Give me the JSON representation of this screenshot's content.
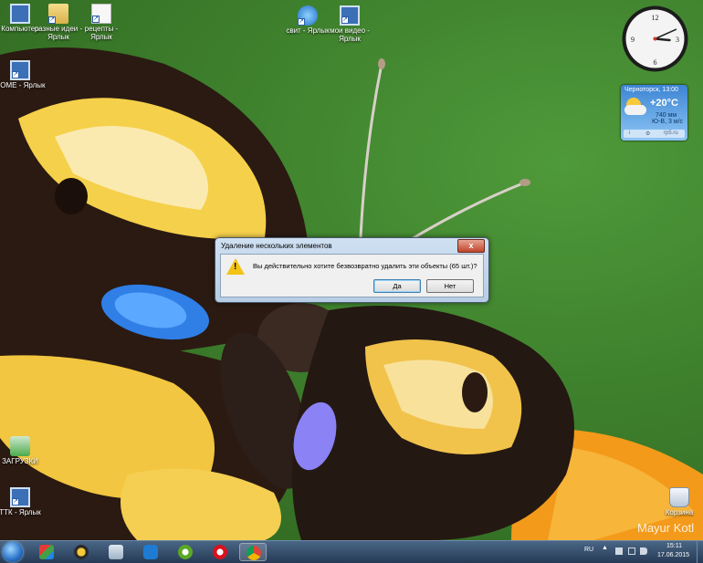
{
  "desktop_icons": [
    {
      "label": "Компьютер",
      "icon": "computer-icon"
    },
    {
      "label": "разные идеи - Ярлык",
      "icon": "folder-shortcut-icon"
    },
    {
      "label": "рецепты - Ярлык",
      "icon": "document-shortcut-icon"
    },
    {
      "label": "свит - Ярлык",
      "icon": "globe-shortcut-icon"
    },
    {
      "label": "мои видео - Ярлык",
      "icon": "monitor-shortcut-icon"
    },
    {
      "label": "HOME - Ярлык",
      "icon": "computer-shortcut-icon"
    },
    {
      "label": "ЗАГРУЗКИ",
      "icon": "downloads-icon"
    },
    {
      "label": "ТТК - Ярлык",
      "icon": "network-shortcut-icon"
    },
    {
      "label": "Корзина",
      "icon": "recycle-bin-icon"
    }
  ],
  "clock_gadget": {
    "numerals": [
      "12",
      "3",
      "6",
      "9"
    ],
    "time": "15:11"
  },
  "weather_gadget": {
    "city_time": "Черноторск, 13:00",
    "temperature": "+20°C",
    "pressure": "740 мм",
    "wind": "Ю-В, 3 м/с",
    "footer_info": "i",
    "footer_site": "rp5.ru"
  },
  "dialog": {
    "title": "Удаление нескольких элементов",
    "close_label": "x",
    "message": "Вы действительно хотите безвозвратно удалить эти объекты (65 шт.)?",
    "yes_label": "Да",
    "no_label": "Нет"
  },
  "watermark": "Mayur Kotl",
  "taskbar": {
    "apps": [
      "start-orb",
      "app-x",
      "app-aimp",
      "app-calculator",
      "app-maxthon",
      "app-utorrent",
      "app-opera",
      "app-chrome"
    ],
    "language": "RU",
    "time": "15:11",
    "date": "17.06.2015"
  },
  "colors": {
    "dialog_bg": "#f0f0f0",
    "taskbar": "#2f4868",
    "warning": "#f3c316"
  }
}
